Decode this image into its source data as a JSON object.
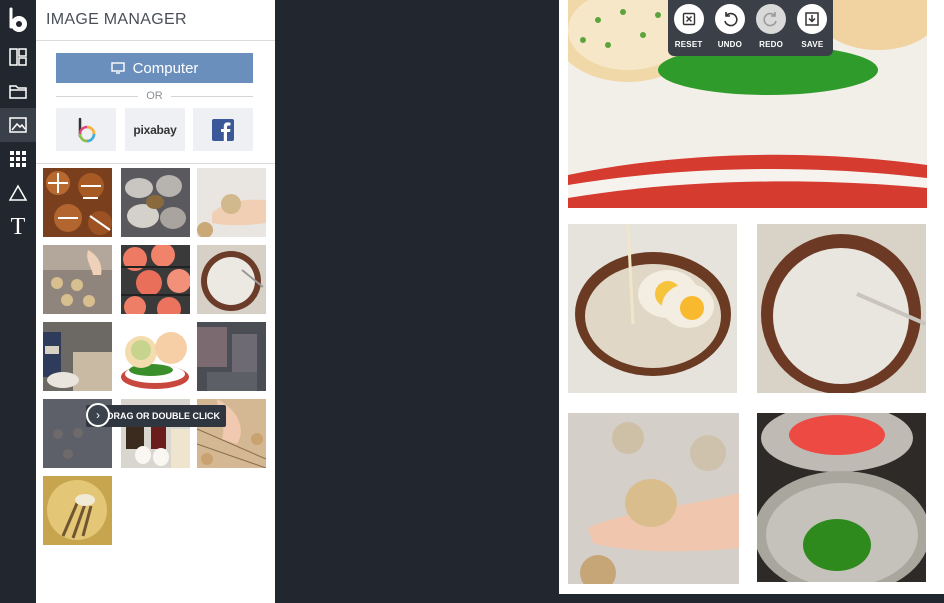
{
  "panel": {
    "title": "IMAGE MANAGER",
    "computer_button": "Computer",
    "or_text": "OR",
    "sources": {
      "pixabay": "pixabay"
    },
    "tooltip": "DRAG OR DOUBLE CLICK"
  },
  "toolbar": {
    "tools": [
      "logo-icon",
      "layout-icon",
      "folder-icon",
      "image-icon",
      "grid-icon",
      "shape-icon",
      "text-icon"
    ],
    "text_glyph": "T"
  },
  "edit_bar": {
    "reset": "RESET",
    "undo": "UNDO",
    "redo": "REDO",
    "save": "SAVE"
  },
  "colors": {
    "sidebar_bg": "#22272f",
    "accent_button": "#6b8fbd",
    "facebook_blue": "#3b5998",
    "edit_bar_bg": "#3b4048"
  }
}
